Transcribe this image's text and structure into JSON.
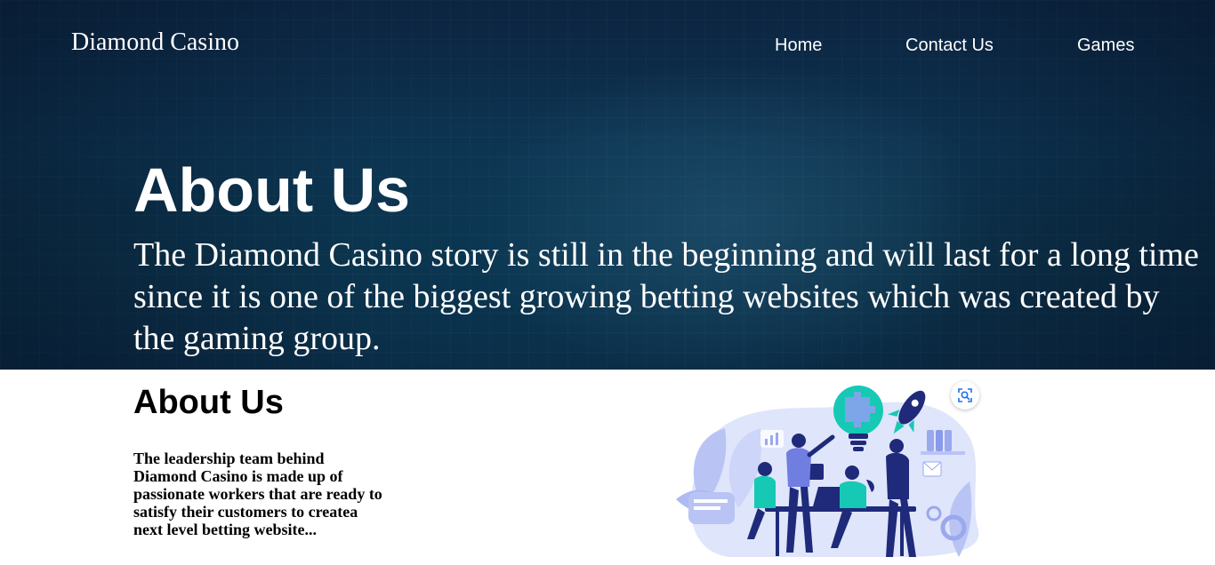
{
  "header": {
    "brand": "Diamond Casino",
    "nav": [
      "Home",
      "Contact Us",
      "Games"
    ]
  },
  "hero": {
    "title": "About Us",
    "text": "The Diamond Casino story is still in the beginning and will last for a long time since it is one of the biggest growing betting websites which was created by the gaming group."
  },
  "about": {
    "title": "About Us",
    "text": "The leadership team behind Diamond Casino is made up of passionate workers that are ready to satisfy their customers to createa next level betting website..."
  },
  "illustration": {
    "icon": "team-meeting-illustration",
    "lens_icon": "image-search-icon",
    "colors": {
      "primary": "#1f2a7a",
      "accent": "#16c9b4",
      "light": "#b9c4f5"
    }
  }
}
